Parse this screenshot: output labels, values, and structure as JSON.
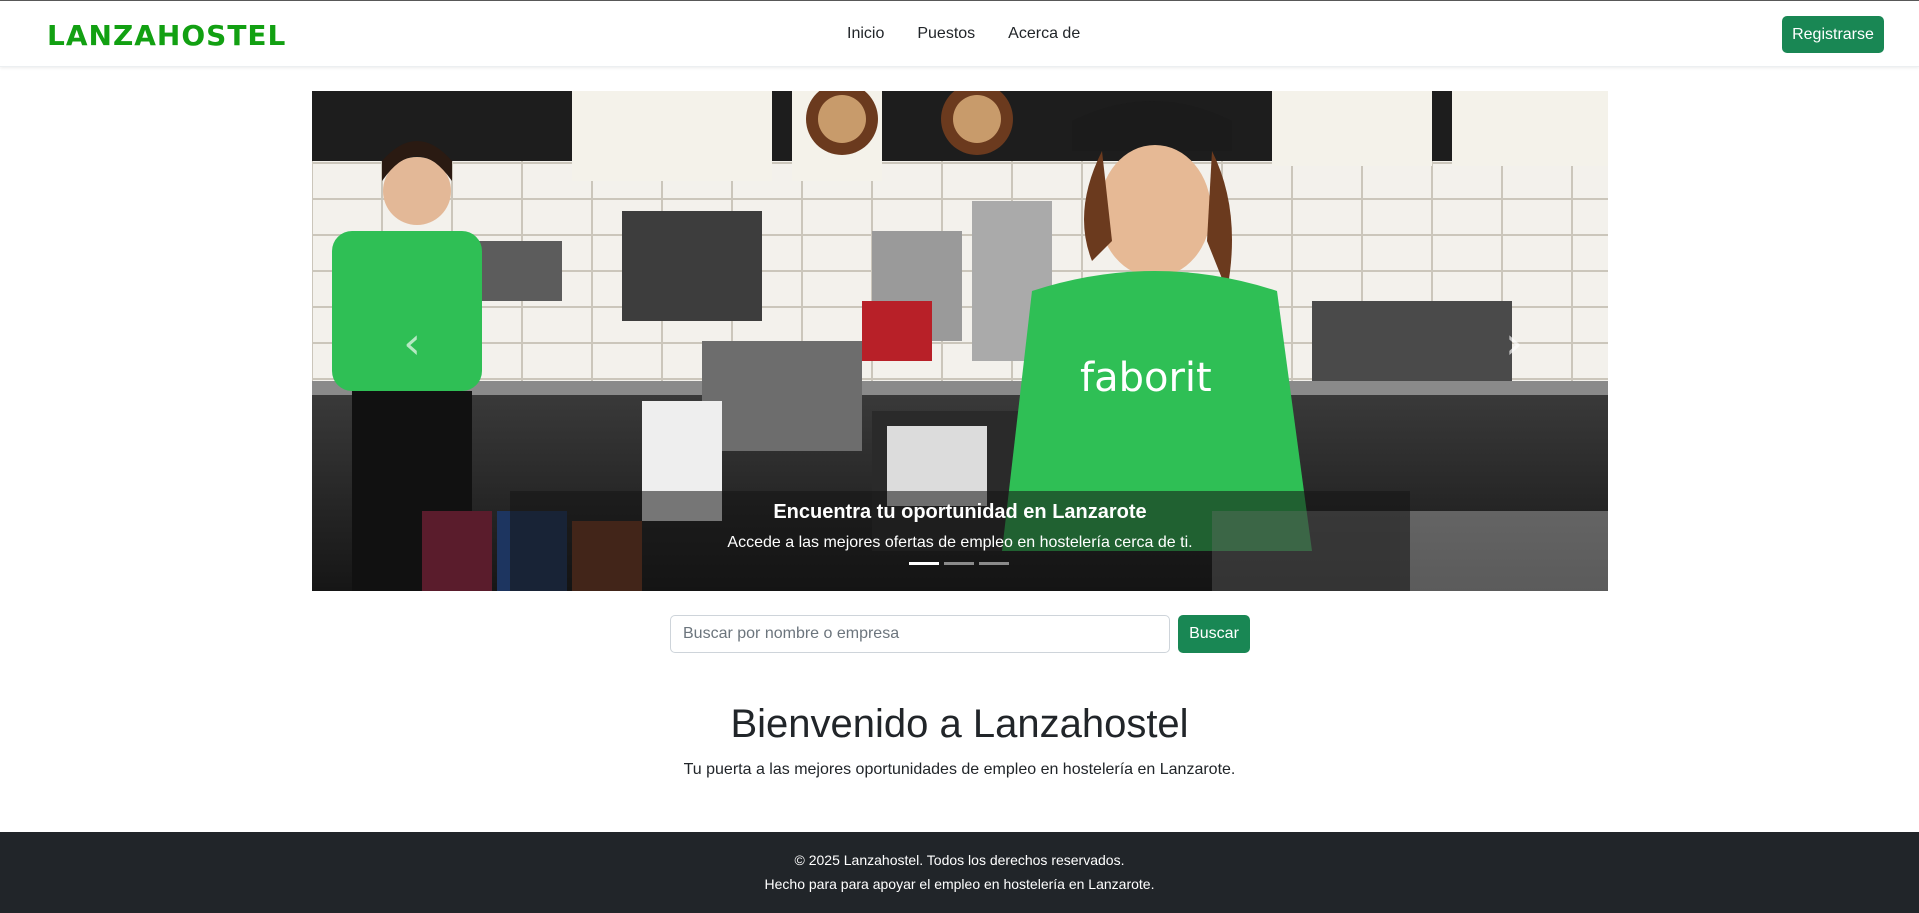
{
  "header": {
    "brand": "LANZAHOSTEL",
    "nav": [
      "Inicio",
      "Puestos",
      "Acerca de"
    ],
    "register_label": "Registrarse"
  },
  "carousel": {
    "caption_title": "Encuentra tu oportunidad en Lanzarote",
    "caption_text": "Accede a las mejores ofertas de empleo en hostelería cerca de ti.",
    "slide_count": 3,
    "active_index": 0,
    "prev_glyph": "‹",
    "next_glyph": "›"
  },
  "search": {
    "placeholder": "Buscar por nombre o empresa",
    "value": "",
    "button_label": "Buscar"
  },
  "welcome": {
    "title": "Bienvenido a Lanzahostel",
    "subtitle": "Tu puerta a las mejores oportunidades de empleo en hostelería en Lanzarote."
  },
  "footer": {
    "line1": "© 2025 Lanzahostel. Todos los derechos reservados.",
    "line2": "Hecho para para apoyar el empleo en hostelería en Lanzarote."
  },
  "colors": {
    "brand": "#12a012",
    "button": "#198754",
    "footer_bg": "#212529",
    "shirt_green": "#2fbf55"
  }
}
